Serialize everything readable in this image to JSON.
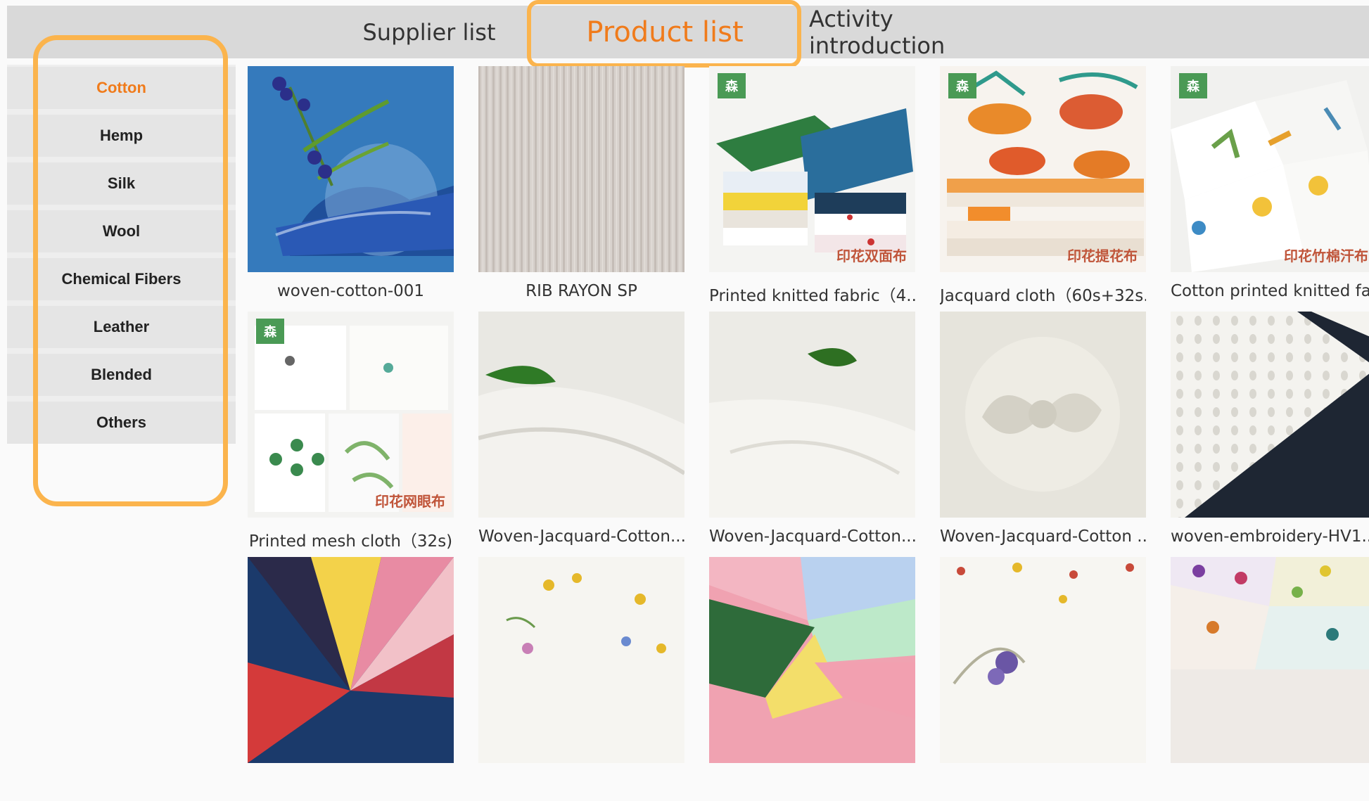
{
  "tabs": {
    "supplier": "Supplier list",
    "product": "Product list",
    "activity": "Activity introduction"
  },
  "sidebar": {
    "items": [
      {
        "label": "Cotton",
        "active": true
      },
      {
        "label": "Hemp"
      },
      {
        "label": "Silk"
      },
      {
        "label": "Wool"
      },
      {
        "label": "Chemical Fibers"
      },
      {
        "label": "Leather"
      },
      {
        "label": "Blended"
      },
      {
        "label": "Others"
      }
    ]
  },
  "products": [
    {
      "name": "woven-cotton-001"
    },
    {
      "name": "RIB RAYON SP"
    },
    {
      "name": "Printed knitted fabric（4...",
      "stamp": "印花双面布"
    },
    {
      "name": "Jacquard cloth（60s+32s...",
      "stamp": "印花提花布"
    },
    {
      "name": "Cotton printed knitted fa...",
      "stamp": "印花竹棉汗布"
    },
    {
      "name": "Printed mesh cloth（32s)",
      "stamp": "印花网眼布"
    },
    {
      "name": "Woven-Jacquard-Cotton..."
    },
    {
      "name": "Woven-Jacquard-Cotton..."
    },
    {
      "name": "Woven-Jacquard-Cotton ..."
    },
    {
      "name": "woven-embroidery-HV1..."
    },
    {
      "name": ""
    },
    {
      "name": ""
    },
    {
      "name": ""
    },
    {
      "name": ""
    },
    {
      "name": ""
    }
  ],
  "badge_text": "森",
  "colors": {
    "accent": "#f07b1b",
    "highlight": "#fbb44d"
  }
}
